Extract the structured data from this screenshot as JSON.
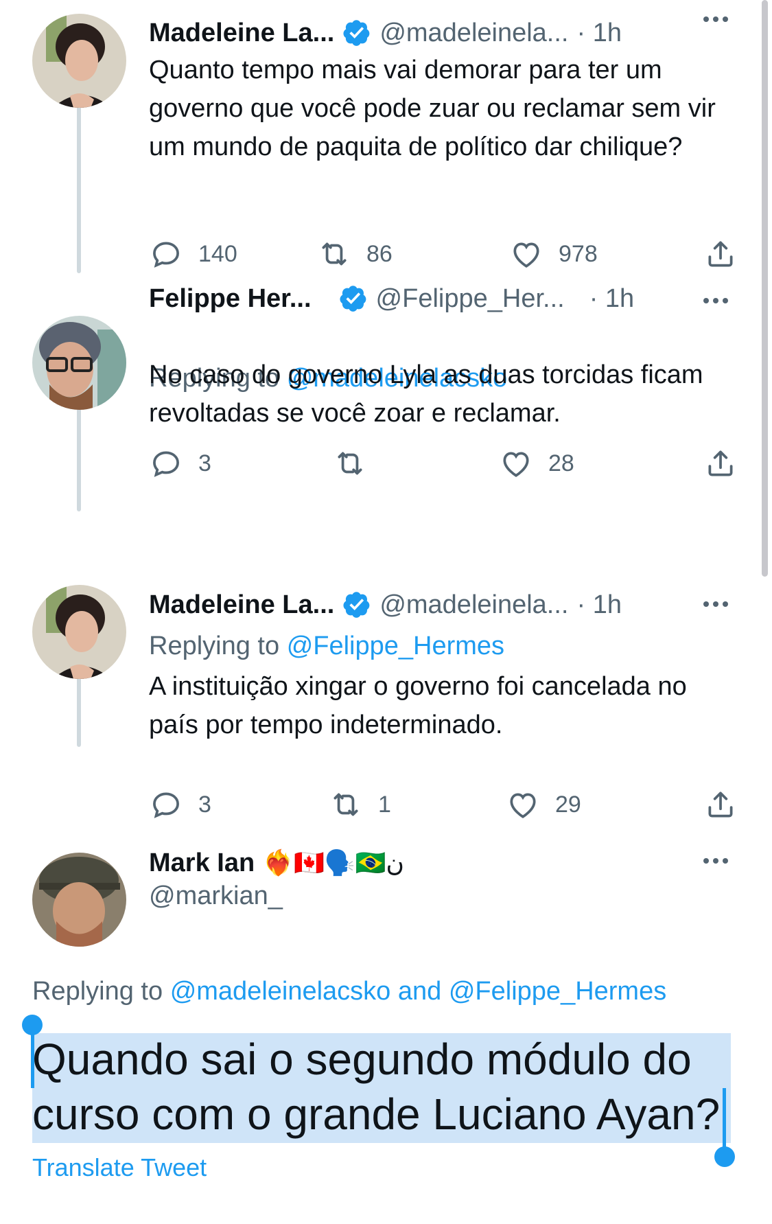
{
  "tweets": [
    {
      "name": "Madeleine La...",
      "handle": "@madeleinela...",
      "time": "· 1h",
      "replying_label": "",
      "replying_to": "",
      "text": "Quanto tempo mais vai demorar para ter um governo que você pode zuar ou reclamar sem vir um mundo de paquita de político dar chilique?",
      "replies": "140",
      "retweets": "86",
      "likes": "978"
    },
    {
      "name": "Felippe Her...",
      "handle": "@Felippe_Her...",
      "time": "· 1h",
      "replying_label": "Replying to",
      "replying_to": "@madeleinelacsko",
      "text": "No caso do governo Lyla as duas torcidas ficam revoltadas se você zoar e reclamar.",
      "replies": "3",
      "retweets": "",
      "likes": "28"
    },
    {
      "name": "Madeleine La...",
      "handle": "@madeleinela...",
      "time": "· 1h",
      "replying_label": "Replying to",
      "replying_to": "@Felippe_Hermes",
      "text": "A instituição xingar o governo foi cancelada no país por tempo indeterminado.",
      "replies": "3",
      "retweets": "1",
      "likes": "29"
    }
  ],
  "main_tweet": {
    "name": "Mark Ian",
    "name_emojis": "❤️‍🔥🇨🇦🗣️🇧🇷ن",
    "handle": "@markian_",
    "replying_label": "Replying to",
    "replying_to_1": "@madeleinelacsko",
    "and_label": "and",
    "replying_to_2": "@Felippe_Hermes",
    "text_line1": "Quando sai o segundo módulo do",
    "text_line2": "curso com o grande Luciano Ayan?",
    "translate_label": "Translate Tweet"
  },
  "colors": {
    "accent": "#1d9bf0",
    "secondary_text": "#536471",
    "primary_text": "#0f1419",
    "thread_line": "#cfd9de",
    "selection": "#cfe4f8"
  },
  "icons": [
    "verified-badge-icon",
    "more-icon",
    "reply-icon",
    "retweet-icon",
    "like-icon",
    "share-icon"
  ]
}
